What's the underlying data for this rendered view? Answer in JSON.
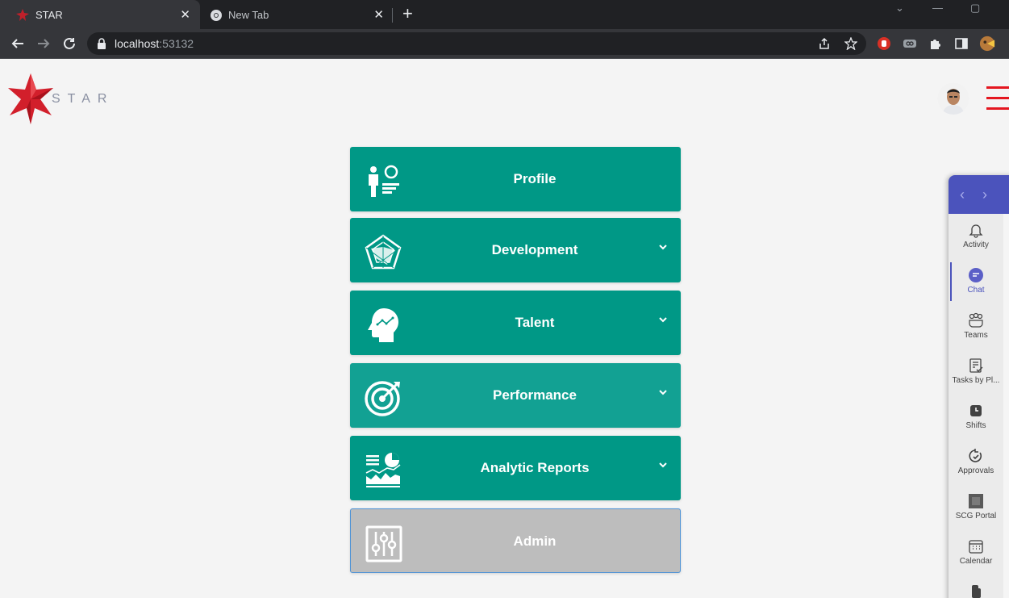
{
  "browser": {
    "tabs": [
      {
        "title": "STAR",
        "active": true,
        "favicon": "star-favicon"
      },
      {
        "title": "New Tab",
        "active": false,
        "favicon": "chrome-favicon"
      }
    ],
    "new_tab_label": "+",
    "url_host": "localhost",
    "url_port": ":53132"
  },
  "app": {
    "logo_text": "STAR",
    "brand_color": "#e4161f",
    "accent_color": "#009886"
  },
  "menu": [
    {
      "label": "Profile",
      "icon": "profile-icon",
      "has_chevron": false
    },
    {
      "label": "Development",
      "icon": "radar-chart-icon",
      "has_chevron": true
    },
    {
      "label": "Talent",
      "icon": "head-brain-icon",
      "has_chevron": true
    },
    {
      "label": "Performance",
      "icon": "target-icon",
      "has_chevron": true
    },
    {
      "label": "Analytic Reports",
      "icon": "report-chart-icon",
      "has_chevron": true
    },
    {
      "label": "Admin",
      "icon": "sliders-icon",
      "has_chevron": false
    }
  ],
  "teams": {
    "items": [
      {
        "label": "Activity",
        "icon": "bell-icon"
      },
      {
        "label": "Chat",
        "icon": "chat-icon",
        "active": true
      },
      {
        "label": "Teams",
        "icon": "teams-icon"
      },
      {
        "label": "Tasks by Pl...",
        "icon": "tasks-icon"
      },
      {
        "label": "Shifts",
        "icon": "clock-icon"
      },
      {
        "label": "Approvals",
        "icon": "approvals-icon"
      },
      {
        "label": "SCG Portal",
        "icon": "portal-icon"
      },
      {
        "label": "Calendar",
        "icon": "calendar-icon"
      }
    ],
    "header_color": "#4b53bc"
  }
}
